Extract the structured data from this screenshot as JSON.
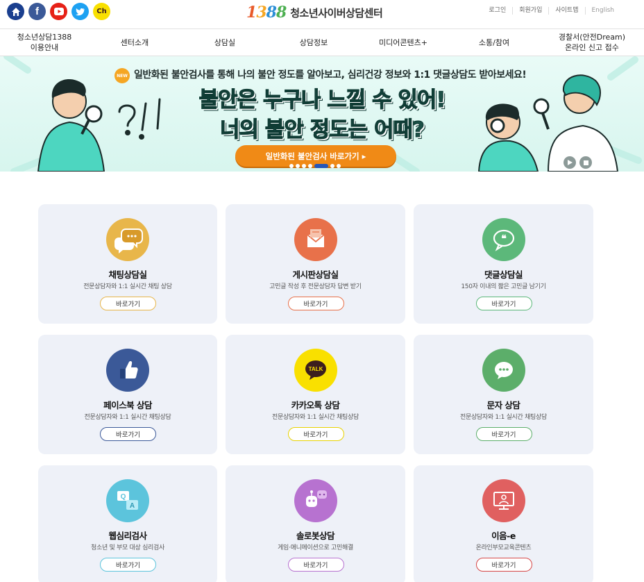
{
  "social": [
    {
      "icon": "home-icon",
      "glyph": "",
      "color": "#1a3f8f"
    },
    {
      "icon": "facebook-icon",
      "glyph": "f",
      "color": "#3b5998"
    },
    {
      "icon": "youtube-icon",
      "glyph": "",
      "color": "#e62117"
    },
    {
      "icon": "twitter-icon",
      "glyph": "",
      "color": "#1da1f2"
    },
    {
      "icon": "kakao-channel-icon",
      "glyph": "Ch",
      "color": "#f9e000"
    }
  ],
  "brand": {
    "number": [
      "1",
      "3",
      "8",
      "8"
    ],
    "name": "청소년사이버상담센터"
  },
  "util_links": [
    "로그인",
    "회원가입",
    "사이트맵",
    "English"
  ],
  "nav": [
    "청소년상담1388\n이용안내",
    "센터소개",
    "상담실",
    "상담정보",
    "미디어콘텐츠+",
    "소통/참여",
    "경찰서(안전Dream)\n온라인 신고 접수"
  ],
  "banner": {
    "badge": "NEW",
    "top_text": "일반화된 불안검사를 통해 나의 불안 정도를 알아보고, 심리건강 정보와 1:1 댓글상담도 받아보세요!",
    "headline_1": "불안은 누구나 느낄 수 있어!",
    "headline_2": "너의 불안 정도는 어때?",
    "cta": "일반화된 불안검사 바로가기 ▸",
    "slides": 7,
    "active_slide": 4
  },
  "cards": [
    {
      "title": "채팅상담실",
      "desc": "전문상담자와 1:1 실시간 채팅 상담",
      "button": "바로가기",
      "icon": "chat-bubble-icon",
      "color": "#e8b64a",
      "border": "#e8b64a",
      "glyph": "⋯"
    },
    {
      "title": "게시판상담실",
      "desc": "고민글 작성 후 전문상담자 답변 받기",
      "button": "바로가기",
      "icon": "envelope-icon",
      "color": "#e8714a",
      "border": "#e8714a",
      "glyph": "✉"
    },
    {
      "title": "댓글상담실",
      "desc": "150자 이내의 짧은 고민글 남기기",
      "button": "바로가기",
      "icon": "quote-bubble-icon",
      "color": "#5cb87a",
      "border": "#5cb87a",
      "glyph": "❝"
    },
    {
      "title": "페이스북 상담",
      "desc": "전문상담자와 1:1 실시간 채팅상담",
      "button": "바로가기",
      "icon": "thumbs-up-icon",
      "color": "#3b5998",
      "border": "#3b5998",
      "glyph": "👍"
    },
    {
      "title": "카카오톡 상담",
      "desc": "전문상담자와 1:1 실시간 채팅상담",
      "button": "바로가기",
      "icon": "kakao-talk-icon",
      "color": "#f9e000",
      "border": "#e8d200",
      "glyph": "TALK"
    },
    {
      "title": "문자 상담",
      "desc": "전문상담자와 1:1 실시간 채팅상담",
      "button": "바로가기",
      "icon": "message-icon",
      "color": "#5cae6a",
      "border": "#5cae6a",
      "glyph": "•••"
    },
    {
      "title": "웹심리검사",
      "desc": "청소년 및 부모 대상 심리검사",
      "button": "바로가기",
      "icon": "qa-bubble-icon",
      "color": "#5cc4dc",
      "border": "#5cc4dc",
      "glyph": "Q A"
    },
    {
      "title": "솔로봇상담",
      "desc": "게임·애니메이션으로 고민해결",
      "button": "바로가기",
      "icon": "robot-icon",
      "color": "#b772d0",
      "border": "#b772d0",
      "glyph": "☺"
    },
    {
      "title": "이음-e",
      "desc": "온라인부모교육콘텐츠",
      "button": "바로가기",
      "icon": "monitor-person-icon",
      "color": "#e06060",
      "border": "#d64646",
      "glyph": "▭"
    }
  ]
}
